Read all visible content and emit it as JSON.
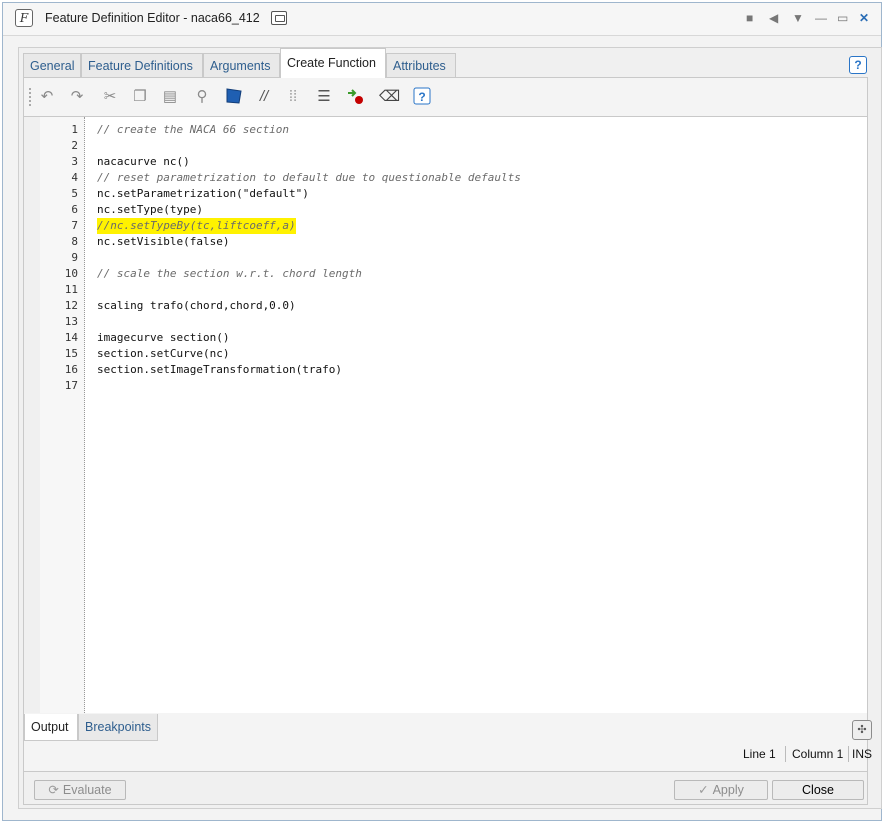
{
  "window": {
    "title": "Feature Definition Editor - naca66_412",
    "controls": [
      "stop-icon",
      "left-arrow-icon",
      "down-arrow-icon",
      "minimize-icon",
      "maximize-icon",
      "close-icon"
    ]
  },
  "tabs": [
    {
      "label": "General"
    },
    {
      "label": "Feature Definitions"
    },
    {
      "label": "Arguments"
    },
    {
      "label": "Create Function",
      "active": true
    },
    {
      "label": "Attributes"
    }
  ],
  "help": {
    "label": "?"
  },
  "toolbar": {
    "icons": [
      "undo-icon",
      "redo-icon",
      "cut-icon",
      "copy-icon",
      "paste-icon",
      "find-icon",
      "bookmark-icon",
      "comment-icon",
      "uncomment-icon",
      "indent-icon",
      "breakpoint-icon",
      "clear-icon",
      "help-icon"
    ]
  },
  "editor": {
    "line_numbers": [
      "1",
      "2",
      "3",
      "4",
      "5",
      "6",
      "7",
      "8",
      "9",
      "10",
      "11",
      "12",
      "13",
      "14",
      "15",
      "16",
      "17"
    ],
    "lines": [
      "// create the NACA 66 section",
      "",
      "nacacurve nc()",
      "// reset parametrization to default due to questionable defaults",
      "nc.setParametrization(\"default\")",
      "nc.setType(type)",
      "//nc.setTypeBy(tc,liftcoeff,a)",
      "nc.setVisible(false)",
      "",
      "// scale the section w.r.t. chord length",
      "",
      "scaling trafo(chord,chord,0.0)",
      "",
      "imagecurve section()",
      "section.setCurve(nc)",
      "section.setImageTransformation(trafo)",
      ""
    ],
    "highlighted_line": 7,
    "highlight_color": "#fff200"
  },
  "bottom_tabs": [
    {
      "label": "Output",
      "active": true
    },
    {
      "label": "Breakpoints"
    }
  ],
  "status": {
    "line": "Line 1",
    "column": "Column 1",
    "mode": "INS"
  },
  "footer": {
    "evaluate": "Evaluate",
    "apply": "Apply",
    "close": "Close"
  },
  "colors": {
    "accent": "#2e5e8e",
    "keyword": "#2a5db0",
    "comment": "#6b6b6b",
    "string": "#0a6a0a"
  }
}
